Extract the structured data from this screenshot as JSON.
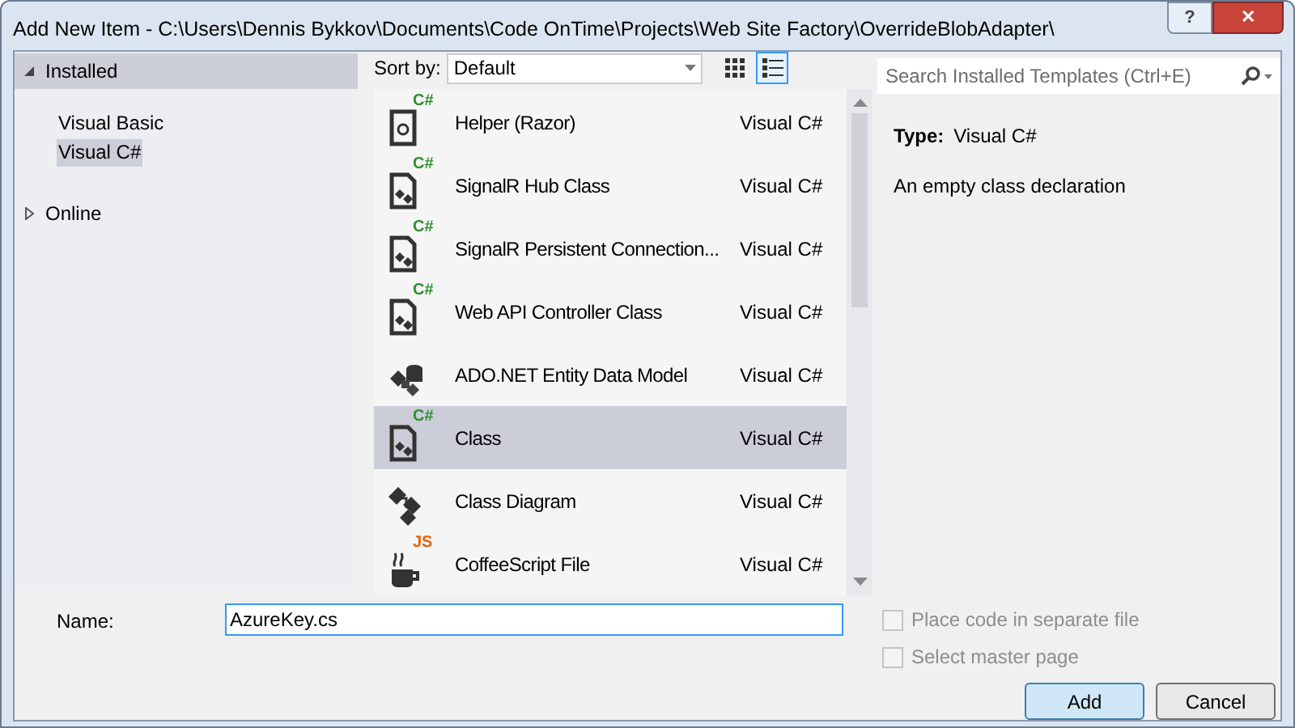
{
  "window": {
    "title": "Add New Item - C:\\Users\\Dennis Bykkov\\Documents\\Code OnTime\\Projects\\Web Site Factory\\OverrideBlobAdapter\\",
    "help": "?",
    "close": "✕"
  },
  "sidebar": {
    "items": [
      {
        "label": "Installed",
        "expanded": true,
        "selected": true,
        "children": [
          {
            "label": "Visual Basic",
            "selected": false
          },
          {
            "label": "Visual C#",
            "selected": true
          }
        ]
      },
      {
        "label": "Online",
        "expanded": false,
        "selected": false
      }
    ]
  },
  "toolbar": {
    "sort_label": "Sort by:",
    "sort_value": "Default",
    "view_modes": [
      {
        "kind": "grid",
        "selected": false
      },
      {
        "kind": "list",
        "selected": true
      }
    ]
  },
  "search": {
    "placeholder": "Search Installed Templates (Ctrl+E)"
  },
  "templates": [
    {
      "kind": "razor",
      "badge": "C#",
      "name": "Helper (Razor)",
      "language": "Visual C#",
      "selected": false
    },
    {
      "kind": "code",
      "badge": "C#",
      "name": "SignalR Hub Class",
      "language": "Visual C#",
      "selected": false
    },
    {
      "kind": "code",
      "badge": "C#",
      "name": "SignalR Persistent Connection...",
      "language": "Visual C#",
      "selected": false
    },
    {
      "kind": "code",
      "badge": "C#",
      "name": "Web API Controller Class",
      "language": "Visual C#",
      "selected": false
    },
    {
      "kind": "entity",
      "name": "ADO.NET Entity Data Model",
      "language": "Visual C#",
      "selected": false
    },
    {
      "kind": "code",
      "badge": "C#",
      "name": "Class",
      "language": "Visual C#",
      "selected": true
    },
    {
      "kind": "diagram",
      "name": "Class Diagram",
      "language": "Visual C#",
      "selected": false
    },
    {
      "kind": "coffee",
      "badge": "JS",
      "name": "CoffeeScript File",
      "language": "Visual C#",
      "selected": false
    }
  ],
  "details": {
    "type_label": "Type:",
    "type_value": "Visual C#",
    "description": "An empty class declaration"
  },
  "name_field": {
    "label": "Name:",
    "value": "AzureKey.cs"
  },
  "options": [
    {
      "label": "Place code in separate file",
      "checked": false,
      "disabled": true
    },
    {
      "label": "Select master page",
      "checked": false,
      "disabled": true
    }
  ],
  "buttons": [
    {
      "label": "Add",
      "default": true
    },
    {
      "label": "Cancel",
      "default": false
    }
  ]
}
